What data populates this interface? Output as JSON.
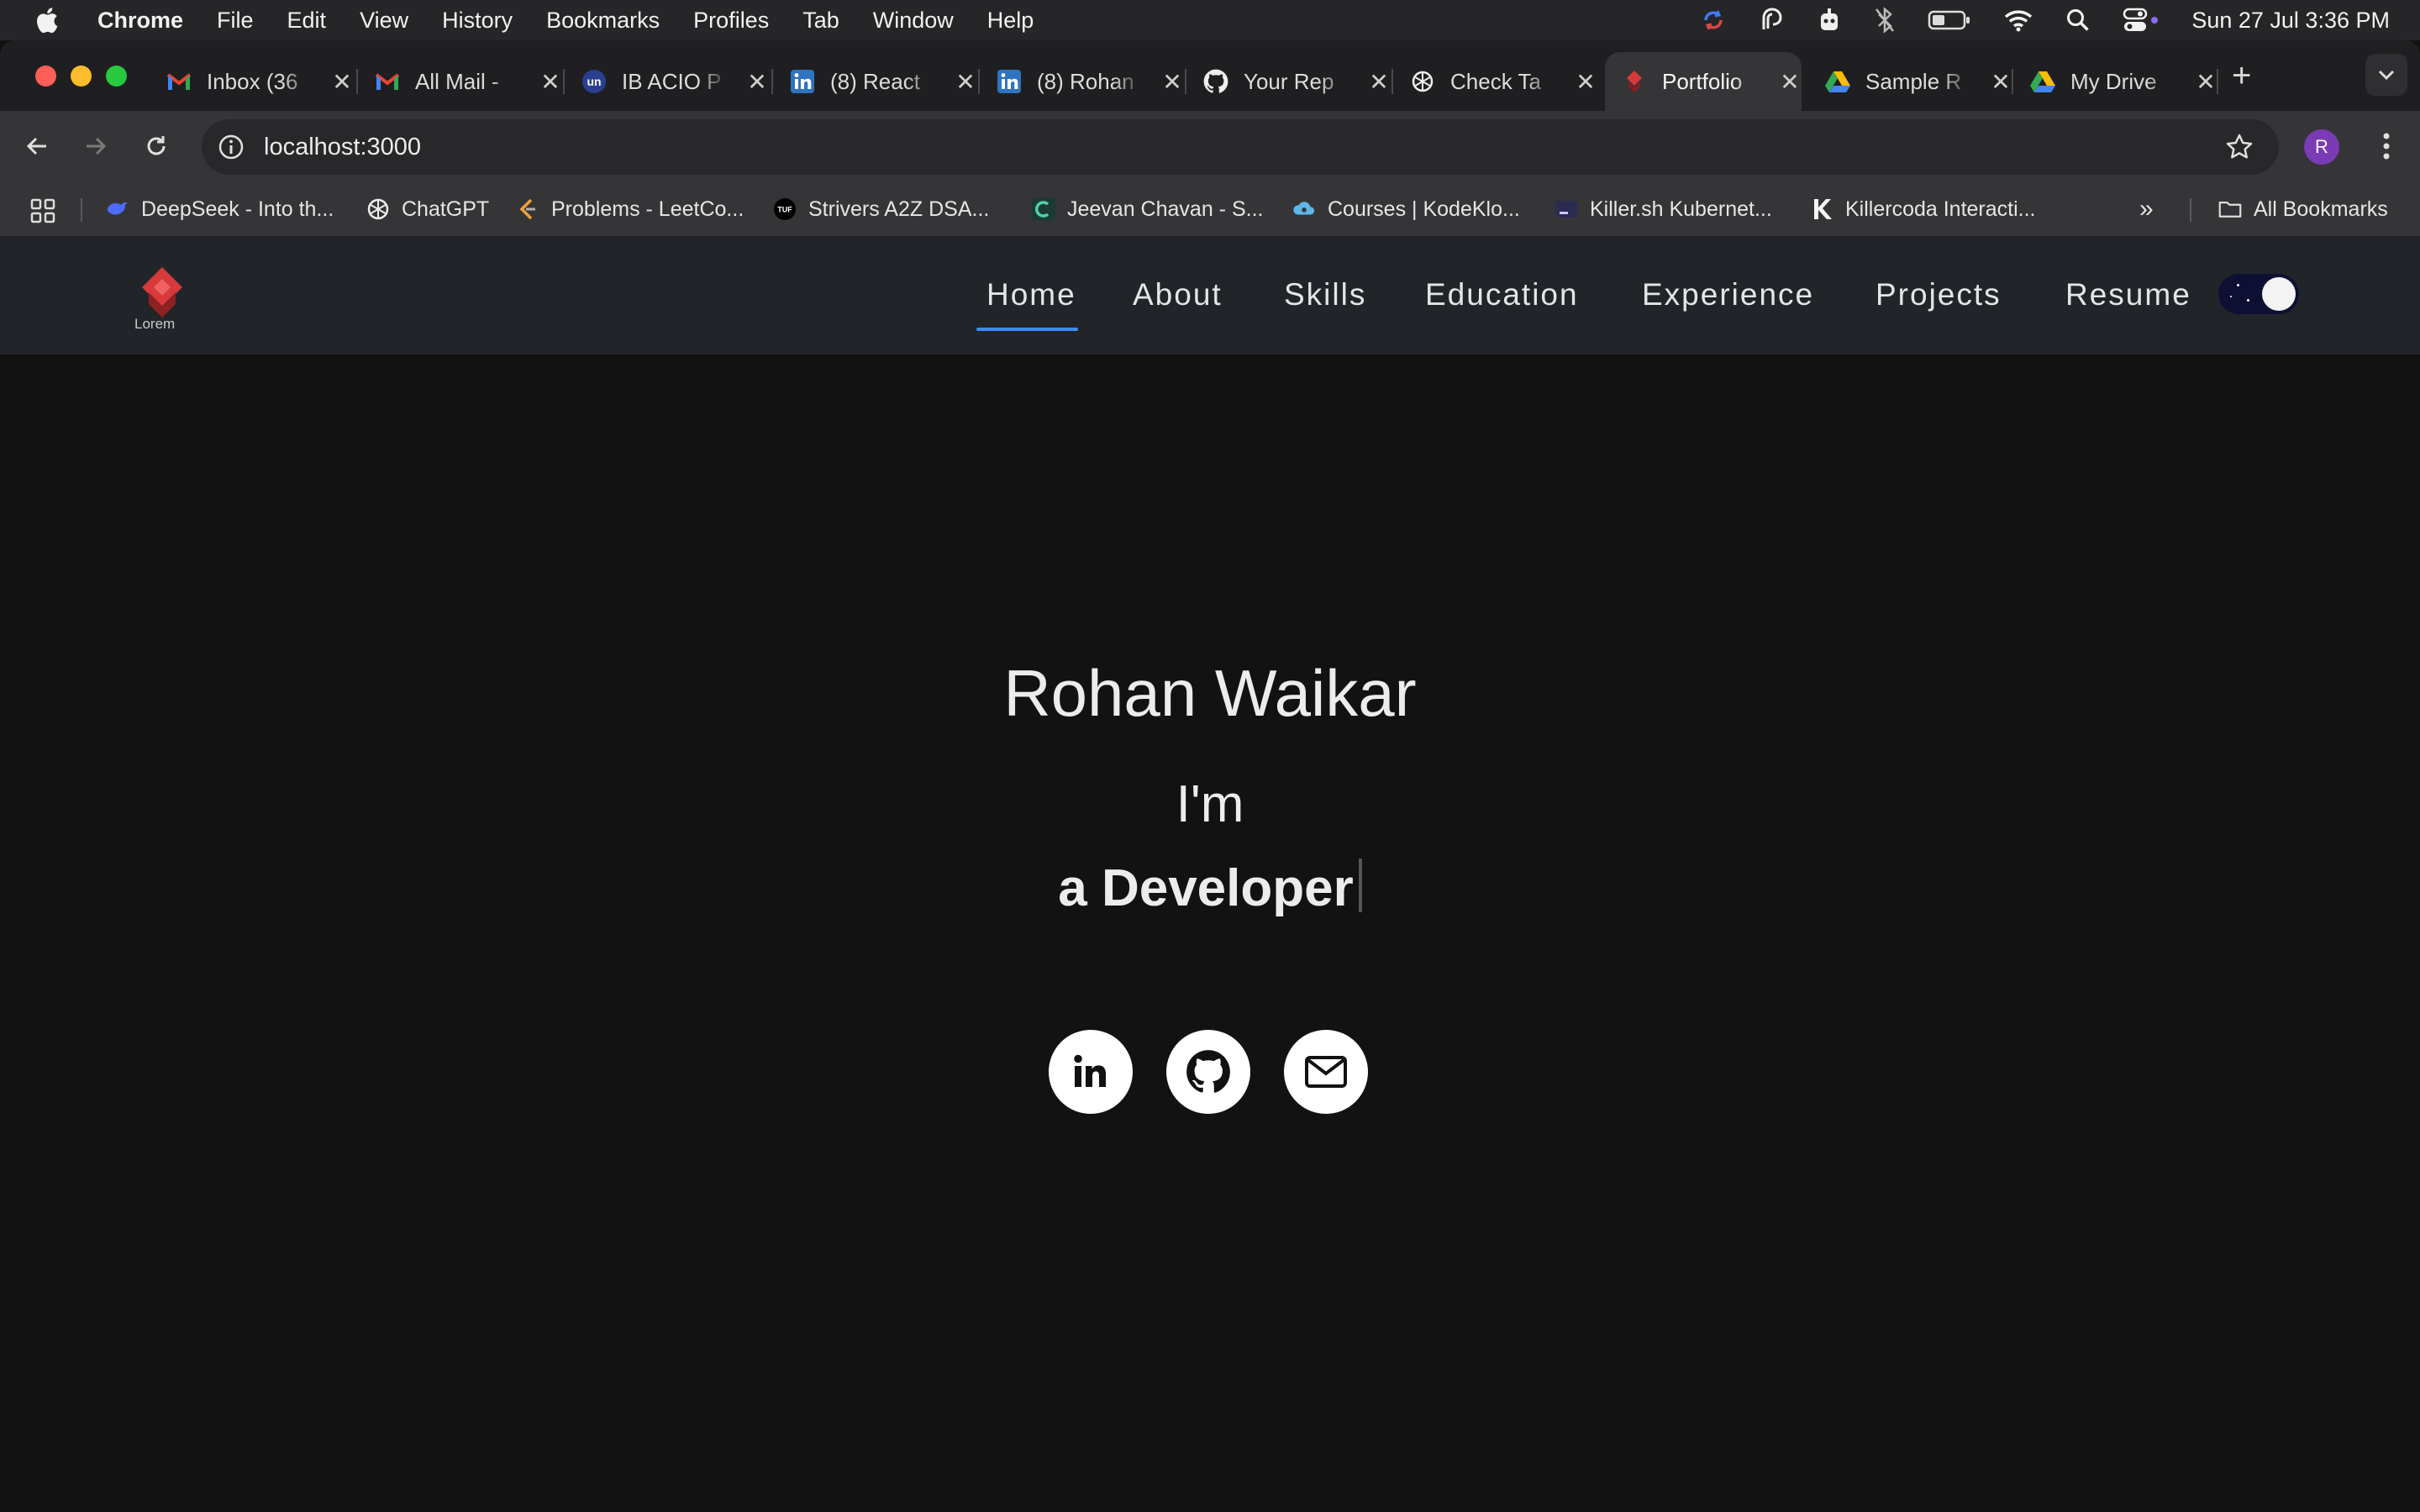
{
  "menubar": {
    "app": "Chrome",
    "items": [
      "File",
      "Edit",
      "View",
      "History",
      "Bookmarks",
      "Profiles",
      "Tab",
      "Window",
      "Help"
    ],
    "clock": "Sun 27 Jul  3:36 PM"
  },
  "tabs": [
    {
      "title": "Inbox (36",
      "icon": "gmail-icon"
    },
    {
      "title": "All Mail -",
      "icon": "gmail-icon"
    },
    {
      "title": "IB ACIO P",
      "icon": "unacademy-icon"
    },
    {
      "title": "(8) React",
      "icon": "linkedin-icon"
    },
    {
      "title": "(8) Rohan",
      "icon": "linkedin-icon"
    },
    {
      "title": "Your Rep",
      "icon": "github-icon"
    },
    {
      "title": "Check Ta",
      "icon": "chatgpt-icon"
    },
    {
      "title": "Portfolio",
      "icon": "portfolio-logo-icon",
      "active": true
    },
    {
      "title": "Sample R",
      "icon": "google-drive-icon"
    },
    {
      "title": "My Drive",
      "icon": "google-drive-icon"
    }
  ],
  "omnibox": {
    "url": "localhost:3000"
  },
  "profile": {
    "initial": "R"
  },
  "bookmarks": [
    {
      "label": "DeepSeek - Into th...",
      "icon": "deepseek-icon"
    },
    {
      "label": "ChatGPT",
      "icon": "chatgpt-icon"
    },
    {
      "label": "Problems - LeetCo...",
      "icon": "leetcode-icon"
    },
    {
      "label": "Strivers A2Z DSA...",
      "icon": "tuf-icon"
    },
    {
      "label": "Jeevan Chavan - S...",
      "icon": "c-icon"
    },
    {
      "label": "Courses | KodeKlo...",
      "icon": "kodekloud-icon"
    },
    {
      "label": "Killer.sh Kubernet...",
      "icon": "terminal-icon"
    },
    {
      "label": "Killercoda Interacti...",
      "icon": "killercoda-icon"
    }
  ],
  "all_bookmarks": "All Bookmarks",
  "site": {
    "logo_text": "Lorem",
    "nav": [
      "Home",
      "About",
      "Skills",
      "Education",
      "Experience",
      "Projects",
      "Resume"
    ],
    "active_nav": "Home",
    "hero": {
      "name": "Rohan Waikar",
      "intro": "I'm",
      "role": "a Developer"
    },
    "socials": [
      "linkedin-icon",
      "github-icon",
      "mail-icon"
    ]
  },
  "colors": {
    "page_bg": "#121212",
    "navbar_bg": "#212529",
    "active_underline": "#3d8bfd",
    "toggle_bg": "#0d1033"
  }
}
